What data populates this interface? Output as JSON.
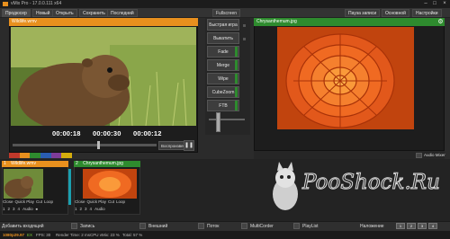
{
  "window": {
    "title": "vMix Pro - 17.0.0.111 x64"
  },
  "menu": {
    "left": [
      "Продюсер",
      "Новый",
      "Открыть",
      "Сохранить",
      "Последний"
    ],
    "right": [
      "Пауза записи",
      "Основной",
      "Настройки"
    ]
  },
  "preview": {
    "title": "Wildlife.wmv",
    "timecodes": [
      "00:00:18",
      "00:00:30",
      "00:00:12"
    ],
    "play_label": "Воспроизвести"
  },
  "transitions": {
    "fullscreen": "Fullscreen",
    "buttons": [
      "Быстрая игра",
      "Выкатить",
      "Fade",
      "Merge",
      "Wipe",
      "CubeZoom",
      "FTB"
    ]
  },
  "output": {
    "title": "Chrysanthemum.jpg",
    "audio_mixer": "Audio Mixer"
  },
  "inputs": [
    {
      "index": "1",
      "name": "Wildlife.wmv",
      "color": "#e8901e",
      "actions": [
        "Close",
        "Quick Play",
        "Cut",
        "Loop"
      ],
      "row2": [
        "1",
        "2",
        "3",
        "4",
        "Audio",
        "⏹"
      ]
    },
    {
      "index": "2",
      "name": "Chrysanthemum.jpg",
      "color": "#2e8b2e",
      "actions": [
        "Close",
        "Quick Play",
        "Cut",
        "Loop"
      ],
      "row2": [
        "1",
        "2",
        "3",
        "4",
        "Audio"
      ]
    }
  ],
  "toolbar": {
    "add_input": "Добавить входящий",
    "record": "Запись",
    "external": "Внешний",
    "stream": "Поток",
    "multicorder": "MultiCorder",
    "playlist": "PlayList",
    "overlay": "Наложение"
  },
  "status": {
    "resolution": "1080p29.97",
    "ex_label": "EX",
    "fps": "FPS: 30",
    "render": "Render Time: 2 ms",
    "cpu": "CPU vMix: 23 %",
    "total": "Total: 57 %"
  },
  "watermark": "PooShock.Ru",
  "colors": {
    "accent_orange": "#e8901e",
    "accent_green": "#2e8b2e",
    "bg": "#2b2b2b"
  }
}
